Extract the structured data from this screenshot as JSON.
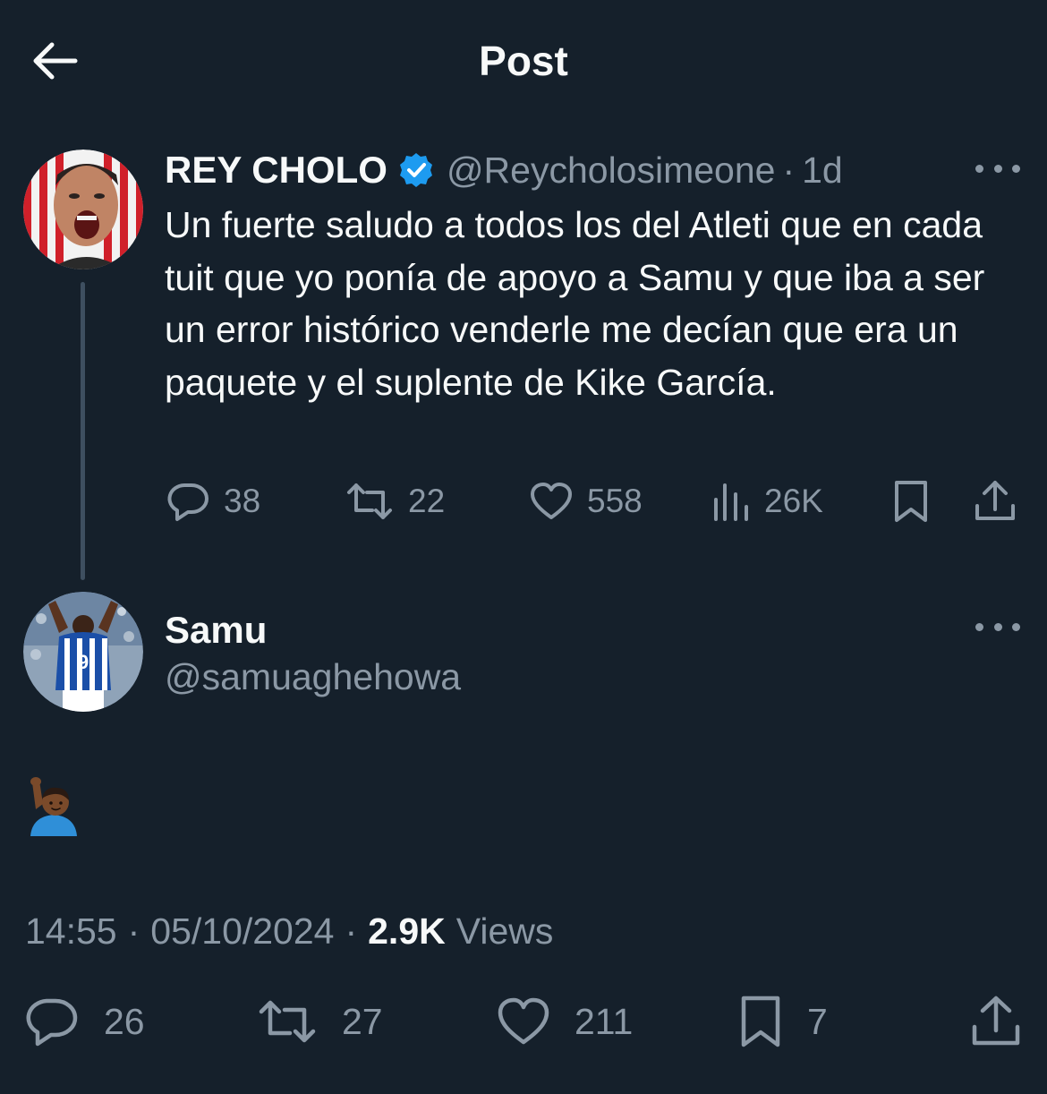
{
  "header": {
    "title": "Post",
    "back_icon": "arrow-left-icon"
  },
  "parent_tweet": {
    "display_name": "REY CHOLO",
    "verified": true,
    "handle": "@Reycholosimeone",
    "separator": "·",
    "time": "1d",
    "text": "Un fuerte saludo a todos los del Atleti que en cada tuit que yo ponía de apoyo a Samu y que iba a ser un error histórico venderle me decían que era un paquete y el suplente de Kike García.",
    "actions": {
      "replies": "38",
      "reposts": "22",
      "likes": "558",
      "views": "26K"
    }
  },
  "reply": {
    "display_name": "Samu",
    "handle": "@samuaghehowa",
    "emoji": "🙋🏾‍♂️",
    "timestamp": "14:55",
    "date": "05/10/2024",
    "separator": "·",
    "views_count": "2.9K",
    "views_label": "Views",
    "actions": {
      "replies": "26",
      "reposts": "27",
      "likes": "211",
      "bookmarks": "7"
    }
  },
  "colors": {
    "background": "#15202b",
    "text_primary": "#f7f9f9",
    "text_secondary": "#8b98a5",
    "verified_blue": "#1d9bf0",
    "thread_line": "#3e4f60"
  }
}
